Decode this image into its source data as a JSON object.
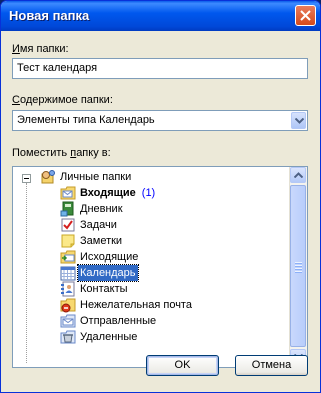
{
  "window": {
    "title": "Новая папка"
  },
  "name_field": {
    "label_mnemonic": "И",
    "label_rest": "мя папки:",
    "value": "Тест календаря"
  },
  "contents_field": {
    "label_mnemonic": "С",
    "label_rest": "одержимое папки:",
    "value": "Элементы типа Календарь"
  },
  "place_field": {
    "label_prefix": "Поместить ",
    "label_mnemonic": "п",
    "label_rest": "апку в:"
  },
  "tree": {
    "root": "Личные папки",
    "items": [
      {
        "label": "Входящие",
        "count": "(1)",
        "icon": "inbox-icon"
      },
      {
        "label": "Дневник",
        "icon": "journal-icon"
      },
      {
        "label": "Задачи",
        "icon": "tasks-icon"
      },
      {
        "label": "Заметки",
        "icon": "notes-icon"
      },
      {
        "label": "Исходящие",
        "icon": "outbox-icon"
      },
      {
        "label": "Календарь",
        "icon": "calendar-icon",
        "selected": true
      },
      {
        "label": "Контакты",
        "icon": "contacts-icon"
      },
      {
        "label": "Нежелательная почта",
        "icon": "junk-mail-icon"
      },
      {
        "label": "Отправленные",
        "icon": "sent-items-icon"
      },
      {
        "label": "Удаленные",
        "icon": "deleted-items-icon"
      }
    ]
  },
  "buttons": {
    "ok": "OK",
    "cancel": "Отмена"
  },
  "colors": {
    "titlebar": "#0058ee",
    "selection": "#316ac5",
    "dialog_bg": "#ece9d8"
  }
}
